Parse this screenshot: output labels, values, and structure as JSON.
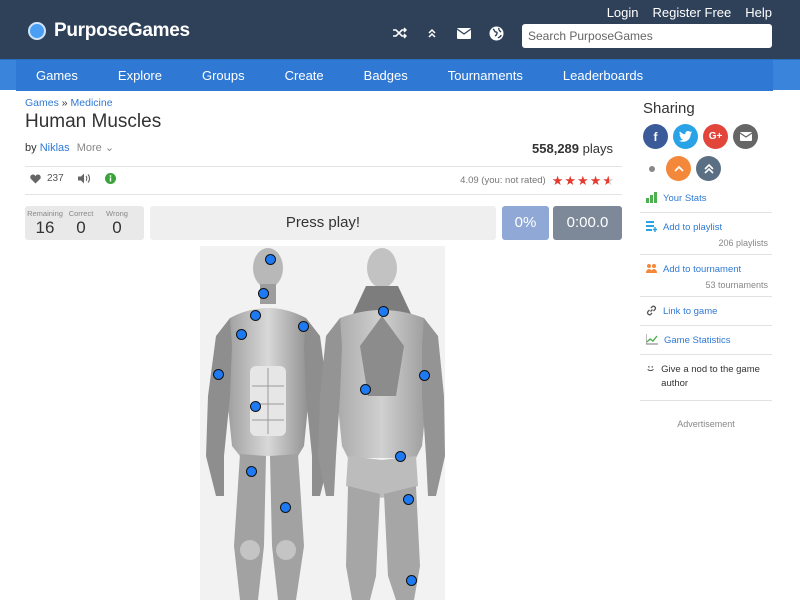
{
  "header": {
    "logo_text": "PurposeGames",
    "links": [
      "Login",
      "Register Free",
      "Help"
    ],
    "icons": [
      "shuffle-icon",
      "chevron-up-icon",
      "envelope-icon",
      "globe-icon"
    ],
    "search_placeholder": "Search PurposeGames"
  },
  "nav": [
    "Games",
    "Explore",
    "Groups",
    "Create",
    "Badges",
    "Tournaments",
    "Leaderboards"
  ],
  "breadcrumb": {
    "root": "Games",
    "sep": "»",
    "category": "Medicine"
  },
  "title": "Human Muscles",
  "byline": {
    "prefix": "by",
    "author": "Niklas",
    "more": "More"
  },
  "plays": {
    "count": "558,289",
    "label": "plays"
  },
  "stats": {
    "likes": "237"
  },
  "rating": {
    "text": "4.09 (you: not rated)",
    "value": 4.09,
    "max": 5
  },
  "score": {
    "remaining_label": "Remaining",
    "remaining": "16",
    "correct_label": "Correct",
    "correct": "0",
    "wrong_label": "Wrong",
    "wrong": "0"
  },
  "play_label": "Press play!",
  "percent": "0%",
  "timer": "0:00.0",
  "sidebar": {
    "title": "Sharing",
    "items": [
      {
        "label": "Your Stats",
        "sub": ""
      },
      {
        "label": "Add to playlist",
        "sub": "206 playlists"
      },
      {
        "label": "Add to tournament",
        "sub": "53 tournaments"
      },
      {
        "label": "Link to game",
        "sub": ""
      },
      {
        "label": "Game Statistics",
        "sub": ""
      },
      {
        "label": "Give a nod to the game author",
        "sub": ""
      }
    ],
    "ad": "Advertisement"
  },
  "colors": {
    "header": "#2f4159",
    "nav": "#2f79d4",
    "link": "#2f79d4",
    "star": "#e63a2e",
    "pin": "#1d7af2"
  }
}
